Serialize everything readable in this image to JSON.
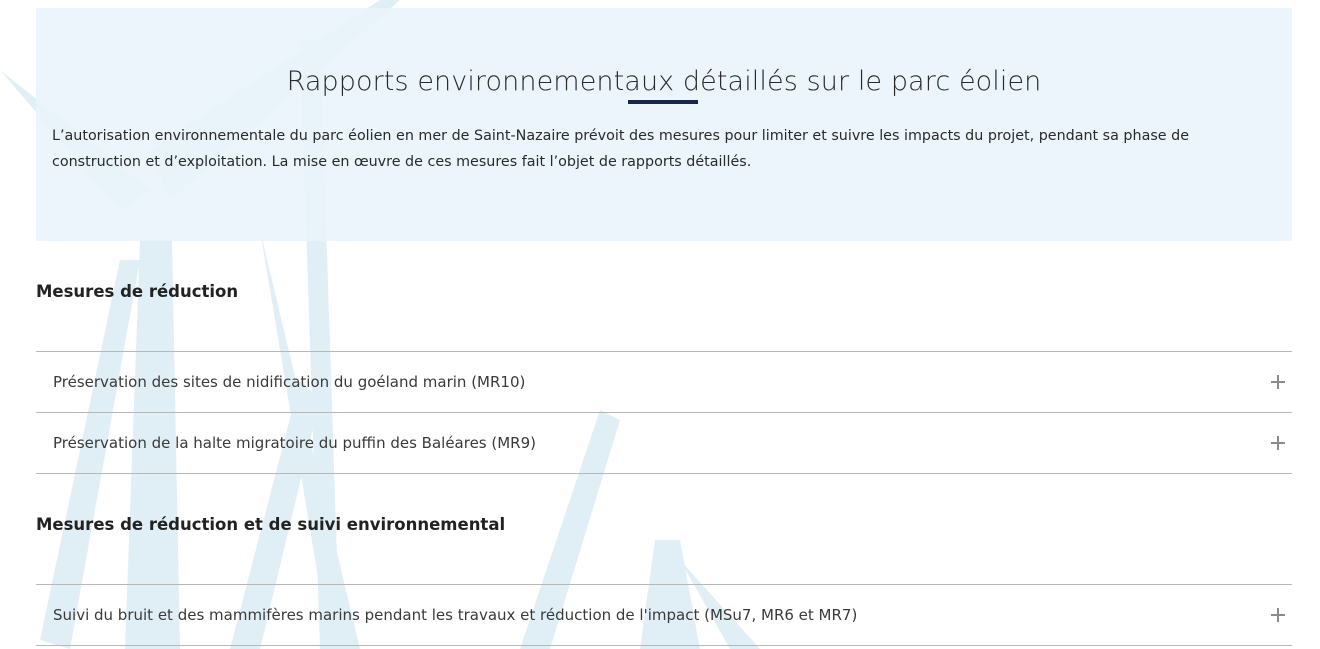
{
  "hero": {
    "title": "Rapports environnementaux détaillés sur le parc éolien",
    "text": "L’autorisation environnementale du parc éolien en mer de Saint-Nazaire prévoit des mesures pour limiter et suivre les impacts du projet, pendant sa phase de construction et d’exploitation. La mise en œuvre de ces mesures fait l’objet de rapports détaillés."
  },
  "sections": [
    {
      "title": "Mesures de réduction",
      "items": [
        {
          "label": "Préservation des sites de nidification du goéland marin (MR10)",
          "icon": "plus-icon"
        },
        {
          "label": "Préservation de la halte migratoire du puffin des Baléares (MR9)",
          "icon": "plus-icon"
        }
      ]
    },
    {
      "title": "Mesures de réduction et de suivi environnemental",
      "items": [
        {
          "label": "Suivi du bruit et des mammifères marins pendant les travaux et réduction de l'impact (MSu7, MR6 et MR7)",
          "icon": "plus-icon"
        }
      ]
    }
  ],
  "colors": {
    "hero_background": "#e8f4fa",
    "title_underline": "#18264a",
    "divider": "#b8b8b8",
    "turbine_decor": "#d2e8f2"
  }
}
